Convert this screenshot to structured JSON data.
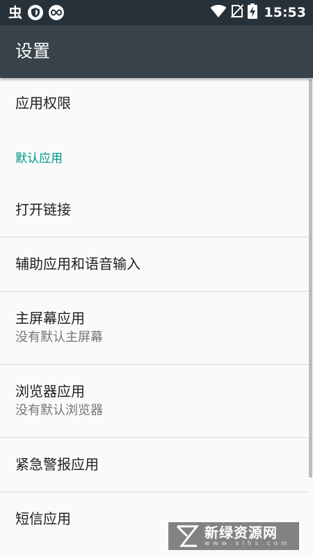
{
  "status_bar": {
    "left_glyph": "虫",
    "time": "15:53",
    "icons": [
      "bug-icon",
      "shield-icon",
      "infinity-icon",
      "wifi-icon",
      "no-sim-icon",
      "battery-charging-icon"
    ]
  },
  "toolbar": {
    "title": "设置"
  },
  "list": {
    "app_permissions": {
      "title": "应用权限"
    },
    "section_default_apps": "默认应用",
    "open_links": {
      "title": "打开链接"
    },
    "assist_voice_input": {
      "title": "辅助应用和语音输入"
    },
    "home_app": {
      "title": "主屏幕应用",
      "summary": "没有默认主屏幕"
    },
    "browser_app": {
      "title": "浏览器应用",
      "summary": "没有默认浏览器"
    },
    "emergency_alerts": {
      "title": "紧急警报应用"
    },
    "sms_app": {
      "title": "短信应用"
    }
  },
  "watermark": {
    "text": "新绿资源网",
    "url": "w w w . x l h s . c o m"
  },
  "colors": {
    "status_bar_bg": "#27313a",
    "toolbar_bg": "#37424a",
    "section_header": "#009688",
    "background": "#fafafa"
  }
}
